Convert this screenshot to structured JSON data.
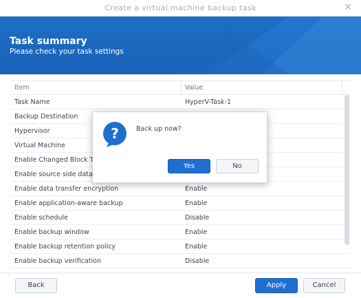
{
  "window": {
    "title": "Create a virtual machine backup task",
    "close_icon": "close-icon"
  },
  "banner": {
    "heading": "Task summary",
    "subheading": "Please check your task settings"
  },
  "table": {
    "columns": [
      "Item",
      "Value"
    ],
    "rows": [
      {
        "item": "Task Name",
        "value": "HyperV-Task-1"
      },
      {
        "item": "Backup Destination",
        "value": ""
      },
      {
        "item": "Hypervisor",
        "value": ""
      },
      {
        "item": "Virtual Machine",
        "value": ""
      },
      {
        "item": "Enable Changed Block Tr",
        "value": ""
      },
      {
        "item": "Enable source side data c",
        "value": ""
      },
      {
        "item": "Enable data transfer encryption",
        "value": "Enable"
      },
      {
        "item": "Enable application-aware backup",
        "value": "Enable"
      },
      {
        "item": "Enable schedule",
        "value": "Disable"
      },
      {
        "item": "Enable backup window",
        "value": "Enable"
      },
      {
        "item": "Enable backup retention policy",
        "value": "Enable"
      },
      {
        "item": "Enable backup verification",
        "value": "Disable"
      }
    ]
  },
  "footer": {
    "back_label": "Back",
    "apply_label": "Apply",
    "cancel_label": "Cancel"
  },
  "dialog": {
    "icon": "question-icon",
    "message": "Back up now?",
    "yes_label": "Yes",
    "no_label": "No"
  },
  "colors": {
    "accent": "#1f6fd1",
    "banner": "#1a62b7"
  }
}
